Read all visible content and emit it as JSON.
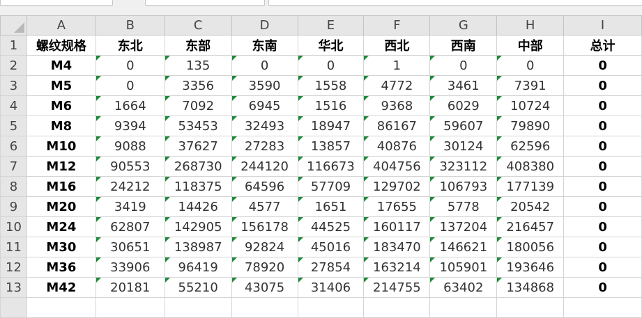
{
  "columns": [
    "A",
    "B",
    "C",
    "D",
    "E",
    "F",
    "G",
    "H",
    "I"
  ],
  "header": [
    "螺纹规格",
    "东北",
    "东部",
    "东南",
    "华北",
    "西北",
    "西南",
    "中部",
    "总计"
  ],
  "rows": [
    {
      "n": "2",
      "spec": "M4",
      "vals": [
        "0",
        "135",
        "0",
        "0",
        "1",
        "0",
        "0"
      ],
      "total": "0"
    },
    {
      "n": "3",
      "spec": "M5",
      "vals": [
        "0",
        "3356",
        "3590",
        "1558",
        "4772",
        "3461",
        "7391"
      ],
      "total": "0"
    },
    {
      "n": "4",
      "spec": "M6",
      "vals": [
        "1664",
        "7092",
        "6945",
        "1516",
        "9368",
        "6029",
        "10724"
      ],
      "total": "0"
    },
    {
      "n": "5",
      "spec": "M8",
      "vals": [
        "9394",
        "53453",
        "32493",
        "18947",
        "86167",
        "59607",
        "79890"
      ],
      "total": "0"
    },
    {
      "n": "6",
      "spec": "M10",
      "vals": [
        "9088",
        "37627",
        "27283",
        "13857",
        "40876",
        "30124",
        "62596"
      ],
      "total": "0"
    },
    {
      "n": "7",
      "spec": "M12",
      "vals": [
        "90553",
        "268730",
        "244120",
        "116673",
        "404756",
        "323112",
        "408380"
      ],
      "total": "0"
    },
    {
      "n": "8",
      "spec": "M16",
      "vals": [
        "24212",
        "118375",
        "64596",
        "57709",
        "129702",
        "106793",
        "177139"
      ],
      "total": "0"
    },
    {
      "n": "9",
      "spec": "M20",
      "vals": [
        "3419",
        "14426",
        "4577",
        "1651",
        "17655",
        "5778",
        "20542"
      ],
      "total": "0"
    },
    {
      "n": "10",
      "spec": "M24",
      "vals": [
        "62807",
        "142905",
        "156178",
        "44525",
        "160117",
        "137204",
        "216457"
      ],
      "total": "0"
    },
    {
      "n": "11",
      "spec": "M30",
      "vals": [
        "30651",
        "138987",
        "92824",
        "45016",
        "183470",
        "146621",
        "180056"
      ],
      "total": "0"
    },
    {
      "n": "12",
      "spec": "M36",
      "vals": [
        "33906",
        "96419",
        "78920",
        "27854",
        "163214",
        "105901",
        "193646"
      ],
      "total": "0"
    },
    {
      "n": "13",
      "spec": "M42",
      "vals": [
        "20181",
        "55210",
        "43075",
        "31406",
        "214755",
        "63402",
        "134868"
      ],
      "total": "0"
    }
  ],
  "colors": {
    "error_triangle": "#1e8a3a",
    "header_bg": "#e6e6e6",
    "gridline": "#d4d4d4"
  }
}
